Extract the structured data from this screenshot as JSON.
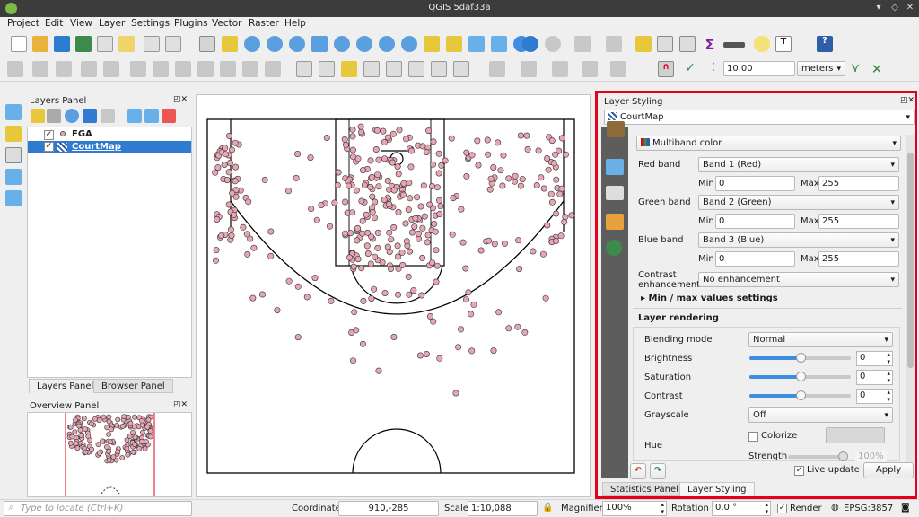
{
  "window": {
    "title": "QGIS 5daf33a"
  },
  "menu": [
    "Project",
    "Edit",
    "View",
    "Layer",
    "Settings",
    "Plugins",
    "Vector",
    "Raster",
    "Help"
  ],
  "toolbar": {
    "snap_tolerance": "10.00",
    "snap_units": "meters"
  },
  "layers_panel": {
    "title": "Layers Panel",
    "layers": [
      {
        "name": "FGA",
        "checked": true,
        "selected": false
      },
      {
        "name": "CourtMap",
        "checked": true,
        "selected": true
      }
    ],
    "tabs": [
      "Layers Panel",
      "Browser Panel"
    ]
  },
  "overview_panel": {
    "title": "Overview Panel"
  },
  "layer_styling": {
    "title": "Layer Styling",
    "layer": "CourtMap",
    "renderer": "Multiband color",
    "red_band": {
      "label": "Red band",
      "value": "Band 1 (Red)",
      "min": "0",
      "max": "255"
    },
    "green_band": {
      "label": "Green band",
      "value": "Band 2 (Green)",
      "min": "0",
      "max": "255"
    },
    "blue_band": {
      "label": "Blue band",
      "value": "Band 3 (Blue)",
      "min": "0",
      "max": "255"
    },
    "min_label": "Min",
    "max_label": "Max",
    "contrast_label": "Contrast enhancement",
    "contrast_value": "No enhancement",
    "minmax_settings": "Min / max values settings",
    "layer_rendering": "Layer rendering",
    "blending_label": "Blending mode",
    "blending_value": "Normal",
    "brightness_label": "Brightness",
    "brightness_value": "0",
    "saturation_label": "Saturation",
    "saturation_value": "0",
    "contrast2_label": "Contrast",
    "contrast2_value": "0",
    "grayscale_label": "Grayscale",
    "grayscale_value": "Off",
    "hue_label": "Hue",
    "colorize_label": "Colorize",
    "strength_label": "Strength",
    "strength_value": "100%",
    "live_update": "Live update",
    "apply": "Apply",
    "bottom_tabs": [
      "Statistics Panel",
      "Layer Styling"
    ]
  },
  "statusbar": {
    "locate_placeholder": "Type to locate (Ctrl+K)",
    "coordinate_label": "Coordinate",
    "coordinate_value": "910,-285",
    "scale_label": "Scale",
    "scale_value": "1:10,088",
    "magnifier_label": "Magnifier",
    "magnifier_value": "100%",
    "rotation_label": "Rotation",
    "rotation_value": "0.0 °",
    "render_label": "Render",
    "crs": "EPSG:3857"
  },
  "colors": {
    "highlight": "#e3001b",
    "point_fill": "#e8a6b4",
    "selection": "#2f7bd0"
  }
}
